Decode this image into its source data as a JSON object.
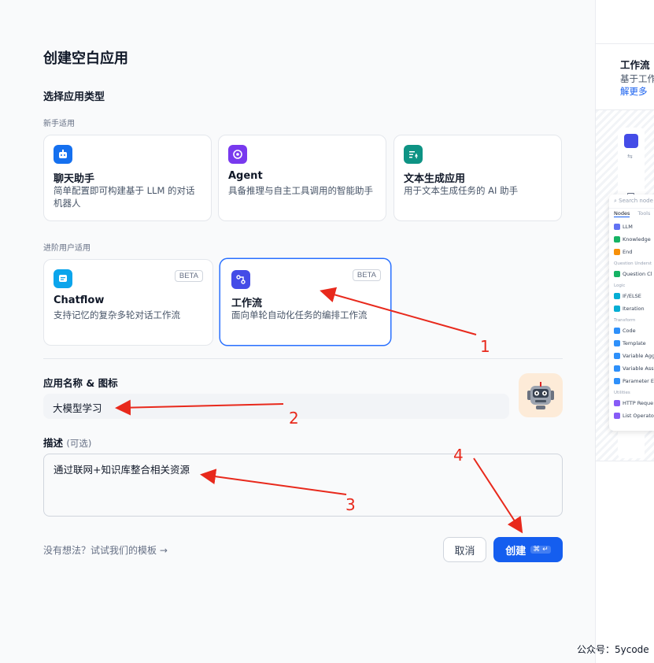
{
  "dialog": {
    "title": "创建空白应用",
    "type_section_title": "选择应用类型",
    "beginner_label": "新手适用",
    "advanced_label": "进阶用户适用"
  },
  "cards": {
    "chat": {
      "title": "聊天助手",
      "desc": "简单配置即可构建基于 LLM 的对话机器人"
    },
    "agent": {
      "title": "Agent",
      "desc": "具备推理与自主工具调用的智能助手"
    },
    "textgen": {
      "title": "文本生成应用",
      "desc": "用于文本生成任务的 AI 助手"
    },
    "chatflow": {
      "title": "Chatflow",
      "desc": "支持记忆的复杂多轮对话工作流",
      "badge": "BETA"
    },
    "workflow": {
      "title": "工作流",
      "desc": "面向单轮自动化任务的编排工作流",
      "badge": "BETA"
    }
  },
  "form": {
    "name_label": "应用名称 & 图标",
    "name_value": "大模型学习",
    "desc_label": "描述",
    "desc_optional": "(可选)",
    "desc_value": "通过联网+知识库整合相关资源"
  },
  "footer": {
    "template_link": "没有想法？试试我们的模板",
    "cancel": "取消",
    "create": "创建",
    "create_shortcut": "⌘ ↵"
  },
  "preview": {
    "title": "工作流",
    "desc": "基于工作",
    "link": "解更多",
    "search_placeholder": "Search node",
    "tabs": [
      "Nodes",
      "Tools"
    ],
    "items_basic": [
      "LLM",
      "Knowledge",
      "End"
    ],
    "group_qu": "Question Underst",
    "items_qu": [
      "Question Cl"
    ],
    "group_logic": "Logic",
    "items_logic": [
      "IF/ELSE",
      "Iteration"
    ],
    "group_transform": "Transform",
    "items_transform": [
      "Code",
      "Template",
      "Variable Agg",
      "Variable Ass",
      "Parameter E"
    ],
    "group_utilities": "Utilities",
    "items_utilities": [
      "HTTP Reque",
      "List Operator"
    ]
  },
  "annotations": [
    "1",
    "2",
    "3",
    "4"
  ],
  "watermark": "公众号：5ycode",
  "colors": {
    "accent": "#155eef",
    "annotation": "#e8291c"
  }
}
